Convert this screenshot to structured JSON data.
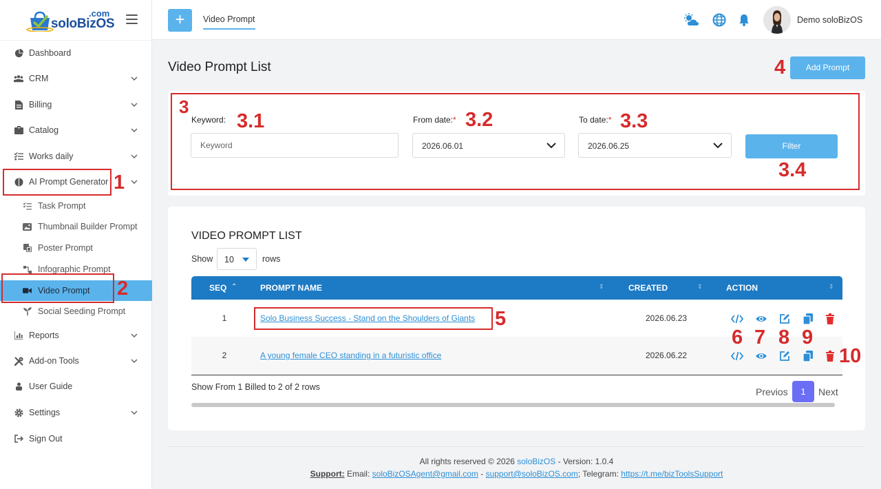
{
  "app": {
    "logo_word": "soloBizOS",
    "logo_com": ".com",
    "colors": {
      "accent": "#5bb3ec",
      "table_header": "#1d7ac4",
      "annotation": "#d62b2b",
      "pagination_active": "#6b6ef5",
      "link": "#2d8fd6"
    }
  },
  "topbar": {
    "plus_icon": "+",
    "tab_label": "Video Prompt",
    "icons": [
      "weather-icon",
      "globe-icon",
      "bell-icon"
    ],
    "user_name": "Demo soloBizOS"
  },
  "sidebar": {
    "items": [
      {
        "label": "Dashboard",
        "icon": "pie-chart-icon",
        "chevron": false
      },
      {
        "label": "CRM",
        "icon": "users-icon",
        "chevron": true
      },
      {
        "label": "Billing",
        "icon": "file-invoice-icon",
        "chevron": true
      },
      {
        "label": "Catalog",
        "icon": "box-icon",
        "chevron": true
      },
      {
        "label": "Works daily",
        "icon": "checklist-icon",
        "chevron": true
      },
      {
        "label": "AI Prompt Generator",
        "icon": "brain-icon",
        "chevron": true
      }
    ],
    "sub_items": [
      {
        "label": "Task Prompt",
        "icon": "task-list-icon"
      },
      {
        "label": "Thumbnail Builder Prompt",
        "icon": "image-icon"
      },
      {
        "label": "Poster Prompt",
        "icon": "poster-icon"
      },
      {
        "label": "Infographic Prompt",
        "icon": "infographic-icon"
      },
      {
        "label": "Video Prompt",
        "icon": "video-camera-icon"
      },
      {
        "label": "Social Seeding Prompt",
        "icon": "seedling-icon"
      }
    ],
    "items_after": [
      {
        "label": "Reports",
        "icon": "reports-icon",
        "chevron": true
      },
      {
        "label": "Add-on Tools",
        "icon": "tools-icon",
        "chevron": true
      },
      {
        "label": "User Guide",
        "icon": "user-guide-icon",
        "chevron": false
      },
      {
        "label": "Settings",
        "icon": "gear-icon",
        "chevron": true
      },
      {
        "label": "Sign Out",
        "icon": "sign-out-icon",
        "chevron": false
      }
    ]
  },
  "main": {
    "title": "Video Prompt List",
    "add_button": "Add Prompt",
    "filter": {
      "keyword_label": "Keyword:",
      "keyword_placeholder": "Keyword",
      "from_label": "From date:",
      "from_value": "2026.06.01",
      "to_label": "To date:",
      "to_value": "2026.06.25",
      "required_mark": "*",
      "filter_button": "Filter"
    },
    "list": {
      "title": "VIDEO PROMPT LIST",
      "show_label": "Show",
      "rows_value": "10",
      "rows_label": "rows",
      "columns": [
        "SEQ",
        "PROMPT NAME",
        "CREATED",
        "ACTION"
      ],
      "rows": [
        {
          "seq": "1",
          "name": "Solo Business Success - Stand on the Shoulders of Giants",
          "created": "2026.06.23"
        },
        {
          "seq": "2",
          "name": "A young female CEO standing in a futuristic office",
          "created": "2026.06.22"
        }
      ],
      "actions": [
        "code-icon",
        "eye-icon",
        "edit-icon",
        "copy-icon",
        "trash-icon"
      ],
      "summary": "Show From 1 Billed to 2 of 2 rows",
      "prev": "Previos",
      "page": "1",
      "next": "Next"
    }
  },
  "annotations": [
    "1",
    "2",
    "3",
    "3.1",
    "3.2",
    "3.3",
    "3.4",
    "4",
    "5",
    "6",
    "7",
    "8",
    "9",
    "10"
  ],
  "footer": {
    "rights_prefix": "All rights reserved © 2026 ",
    "rights_brand": "soloBizOS",
    "rights_suffix": " - Version: 1.0.4",
    "support_label": "Support:",
    "email_label": " Email: ",
    "email1": "soloBizOSAgent@gmail.com",
    "sep": " - ",
    "email2": "support@soloBizOS.com",
    "telegram_label": "; Telegram: ",
    "telegram": "https://t.me/bizToolsSupport"
  }
}
